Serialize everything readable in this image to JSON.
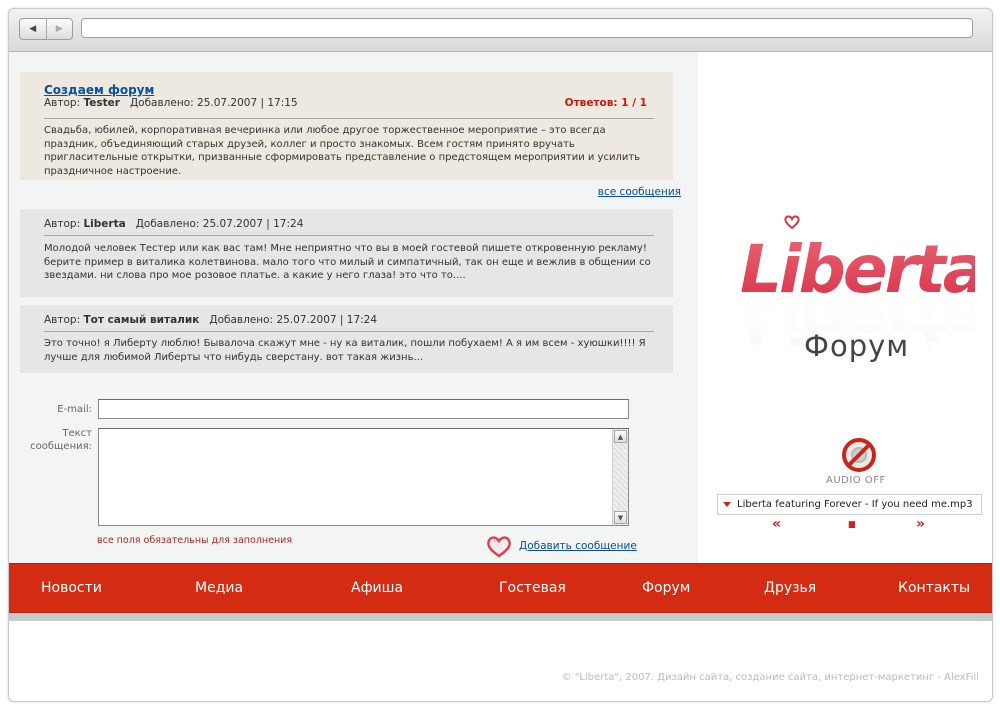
{
  "browser": {
    "back_label": "◀",
    "forward_label": "▶",
    "url": ""
  },
  "topic": {
    "title": "Создаем форум",
    "author_label": "Автор:",
    "author": "Tester",
    "added_label": "Добавлено:",
    "datetime": "25.07.2007 | 17:15",
    "replies": "Ответов: 1 / 1",
    "text": "Свадьба, юбилей, корпоративная вечеринка или любое другое торжественное мероприятие – это всегда праздник, объединяющий старых друзей, коллег и просто знакомых. Всем гостям принято вручать пригласительные открытки, призванные сформировать представление о предстоящем мероприятии и усилить праздничное настроение."
  },
  "all_messages": "все сообщения",
  "posts": [
    {
      "author_label": "Автор:",
      "author": "Liberta",
      "added_label": "Добавлено:",
      "datetime": "25.07.2007 | 17:24",
      "text": "Молодой человек Тестер или как вас там! Мне неприятно что вы в моей гостевой пишете откровенную рекламу! берите пример в виталика колетвинова. мало того что милый и симпатичный, так он еще и вежлив в общении со звездами. ни слова про мое розовое платье. а какие у него глаза! это что то...."
    },
    {
      "author_label": "Автор:",
      "author": "Тот самый виталик",
      "added_label": "Добавлено:",
      "datetime": "25.07.2007 | 17:24",
      "text": "Это точно! я Либерту люблю! Бывалоча скажут мне - ну ка виталик, пошли побухаем! А я им всем - хуюшки!!!! Я лучше для любимой Либерты что нибудь сверстану. вот такая жизнь..."
    }
  ],
  "form": {
    "email_label": "E-mail:",
    "email_value": "",
    "message_label_1": "Текст",
    "message_label_2": "сообщения:",
    "message_value": "",
    "required_note": "все поля обязательны  для заполнения",
    "submit_label": "Добавить сообщение"
  },
  "brand": {
    "logo_text": "Liberta",
    "subtitle": "Форум"
  },
  "player": {
    "audio_status": "AUDIO OFF",
    "track": "Liberta featuring Forever - If you need me.mp3",
    "prev": "«",
    "pause": "▮▮",
    "next": "»"
  },
  "menu": [
    "Новости",
    "Медиа",
    "Афиша",
    "Гостевая",
    "Форум",
    "Друзья",
    "Контакты"
  ],
  "footer": "© \"Liberta\", 2007. Дизайн сайта, создание сайта, интернет-маркетинг - AlexFill",
  "colors": {
    "accent": "#d32c12",
    "link": "#0b4ea2",
    "topic_bg": "#ede8e0",
    "post_bg": "#e6e6e6"
  }
}
